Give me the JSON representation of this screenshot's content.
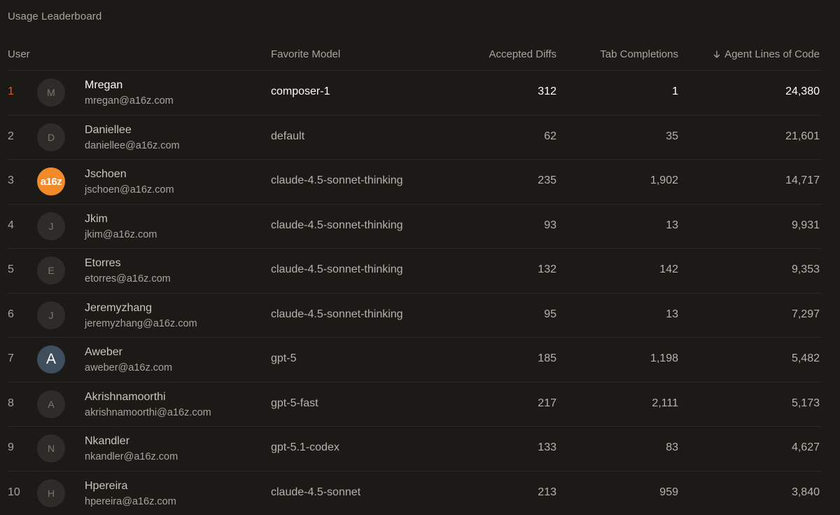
{
  "title": "Usage Leaderboard",
  "columns": {
    "user": "User",
    "model": "Favorite Model",
    "diffs": "Accepted Diffs",
    "tab": "Tab Completions",
    "lines": "Agent Lines of Code"
  },
  "sort": {
    "column": "lines",
    "direction": "desc",
    "icon": "arrow-down-icon"
  },
  "colors": {
    "highlight_rank": "#e8562a",
    "background": "#1c1a17"
  },
  "rows": [
    {
      "rank": "1",
      "initial": "M",
      "name": "Mregan",
      "email": "mregan@a16z.com",
      "model": "composer-1",
      "diffs": "312",
      "tab": "1",
      "lines": "24,380"
    },
    {
      "rank": "2",
      "initial": "D",
      "name": "Daniellee",
      "email": "daniellee@a16z.com",
      "model": "default",
      "diffs": "62",
      "tab": "35",
      "lines": "21,601"
    },
    {
      "rank": "3",
      "initial": "a16z",
      "name": "Jschoen",
      "email": "jschoen@a16z.com",
      "model": "claude-4.5-sonnet-thinking",
      "diffs": "235",
      "tab": "1,902",
      "lines": "14,717"
    },
    {
      "rank": "4",
      "initial": "J",
      "name": "Jkim",
      "email": "jkim@a16z.com",
      "model": "claude-4.5-sonnet-thinking",
      "diffs": "93",
      "tab": "13",
      "lines": "9,931"
    },
    {
      "rank": "5",
      "initial": "E",
      "name": "Etorres",
      "email": "etorres@a16z.com",
      "model": "claude-4.5-sonnet-thinking",
      "diffs": "132",
      "tab": "142",
      "lines": "9,353"
    },
    {
      "rank": "6",
      "initial": "J",
      "name": "Jeremyzhang",
      "email": "jeremyzhang@a16z.com",
      "model": "claude-4.5-sonnet-thinking",
      "diffs": "95",
      "tab": "13",
      "lines": "7,297"
    },
    {
      "rank": "7",
      "initial": "A",
      "name": "Aweber",
      "email": "aweber@a16z.com",
      "model": "gpt-5",
      "diffs": "185",
      "tab": "1,198",
      "lines": "5,482"
    },
    {
      "rank": "8",
      "initial": "A",
      "name": "Akrishnamoorthi",
      "email": "akrishnamoorthi@a16z.com",
      "model": "gpt-5-fast",
      "diffs": "217",
      "tab": "2,111",
      "lines": "5,173"
    },
    {
      "rank": "9",
      "initial": "N",
      "name": "Nkandler",
      "email": "nkandler@a16z.com",
      "model": "gpt-5.1-codex",
      "diffs": "133",
      "tab": "83",
      "lines": "4,627"
    },
    {
      "rank": "10",
      "initial": "H",
      "name": "Hpereira",
      "email": "hpereira@a16z.com",
      "model": "claude-4.5-sonnet",
      "diffs": "213",
      "tab": "959",
      "lines": "3,840"
    }
  ]
}
